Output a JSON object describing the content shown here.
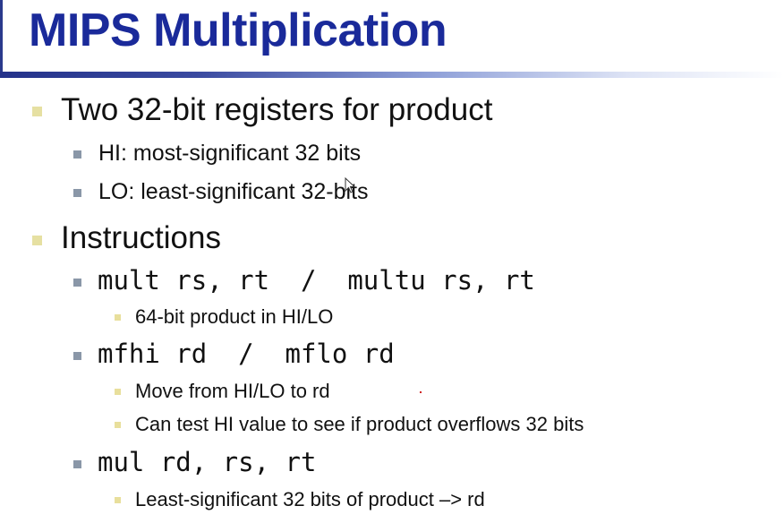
{
  "slide": {
    "title": "MIPS Multiplication",
    "colors": {
      "title": "#1a2a9a",
      "rule_start": "#24328a",
      "level1_bullet": "#e6e0a2",
      "level2_bullet": "#8a97a8",
      "level3_bullet": "#e8df9c"
    },
    "bullets": [
      {
        "text": "Two 32-bit registers for product",
        "children": [
          {
            "text": "HI: most-significant 32 bits"
          },
          {
            "text": "LO: least-significant 32-bits"
          }
        ]
      },
      {
        "text": "Instructions",
        "children": [
          {
            "text": "mult rs, rt  /  multu rs, rt",
            "children": [
              {
                "text": "64-bit product in HI/LO"
              }
            ]
          },
          {
            "text": "mfhi rd  /  mflo rd",
            "children": [
              {
                "text": "Move from HI/LO to rd"
              },
              {
                "text": "Can test HI value to see if product overflows 32 bits"
              }
            ]
          },
          {
            "text": "mul rd, rs, rt",
            "children": [
              {
                "text": "Least-significant 32 bits of product –> rd"
              }
            ]
          }
        ]
      }
    ]
  }
}
